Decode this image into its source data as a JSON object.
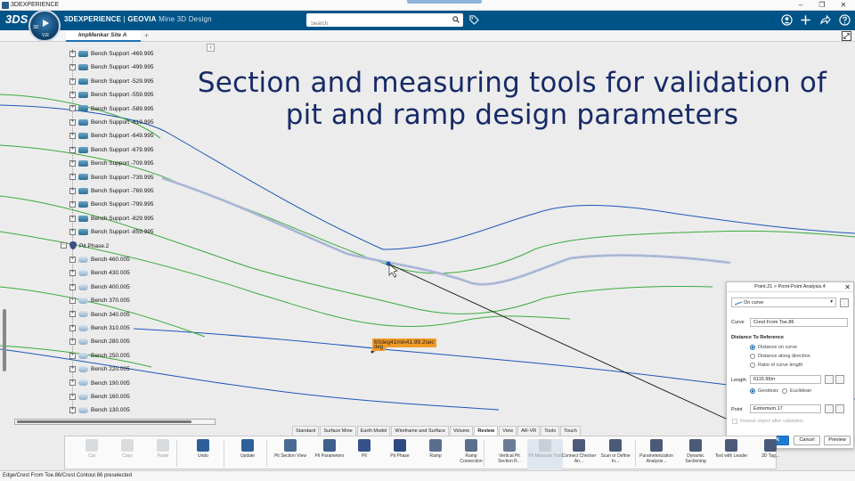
{
  "os_window": {
    "title": "3DEXPERIENCE",
    "min": "–",
    "max": "❐",
    "close": "✕"
  },
  "topbar": {
    "logo": "3DS",
    "compass": {
      "top": "3D",
      "bottom": "V,R"
    },
    "brand_bold": "3DEXPERIENCE",
    "brand_sep": " | ",
    "brand_geovia": "GEOVIA",
    "brand_app": " Mine 3D Design",
    "search_placeholder": "Search",
    "icons": [
      "tag-icon",
      "user-icon",
      "add-icon",
      "share-icon",
      "help-icon"
    ]
  },
  "tabs": {
    "active": "ImpMenkar Site A",
    "add": "+"
  },
  "tree": {
    "collapse": "‹",
    "items": [
      {
        "label": "Bench Support -469.995",
        "type": "support",
        "indent": 1
      },
      {
        "label": "Bench Support -499.995",
        "type": "support",
        "indent": 1
      },
      {
        "label": "Bench Support -529.995",
        "type": "support",
        "indent": 1
      },
      {
        "label": "Bench Support -559.995",
        "type": "support",
        "indent": 1
      },
      {
        "label": "Bench Support -589.995",
        "type": "support",
        "indent": 1
      },
      {
        "label": "Bench Support -619.995",
        "type": "support",
        "indent": 1
      },
      {
        "label": "Bench Support -649.995",
        "type": "support",
        "indent": 1
      },
      {
        "label": "Bench Support -679.995",
        "type": "support",
        "indent": 1
      },
      {
        "label": "Bench Support -709.995",
        "type": "support",
        "indent": 1
      },
      {
        "label": "Bench Support -739.995",
        "type": "support",
        "indent": 1
      },
      {
        "label": "Bench Support -769.995",
        "type": "support",
        "indent": 1
      },
      {
        "label": "Bench Support -799.995",
        "type": "support",
        "indent": 1
      },
      {
        "label": "Bench Support -829.995",
        "type": "support",
        "indent": 1
      },
      {
        "label": "Bench Support -859.995",
        "type": "support",
        "indent": 1
      },
      {
        "label": "Pit Phase.2",
        "type": "phase",
        "indent": 0
      },
      {
        "label": "Bench 460.005",
        "type": "bench",
        "indent": 1
      },
      {
        "label": "Bench 430.005",
        "type": "bench",
        "indent": 1
      },
      {
        "label": "Bench 400.005",
        "type": "bench",
        "indent": 1
      },
      {
        "label": "Bench 370.005",
        "type": "bench",
        "indent": 1
      },
      {
        "label": "Bench 340.005",
        "type": "bench",
        "indent": 1
      },
      {
        "label": "Bench 310.005",
        "type": "bench",
        "indent": 1
      },
      {
        "label": "Bench 280.005",
        "type": "bench",
        "indent": 1
      },
      {
        "label": "Bench 250.005",
        "type": "bench",
        "indent": 1
      },
      {
        "label": "Bench 220.005",
        "type": "bench",
        "indent": 1
      },
      {
        "label": "Bench 190.005",
        "type": "bench",
        "indent": 1
      },
      {
        "label": "Bench 160.005",
        "type": "bench",
        "indent": 1
      },
      {
        "label": "Bench 130.005",
        "type": "bench",
        "indent": 1
      }
    ]
  },
  "heading": {
    "line1": "Section and measuring  tools for validation of",
    "line2": "pit and ramp design parameters"
  },
  "viewport": {
    "angle_label": "60deg41min41.99.2sec",
    "angle_label_sub": "deg"
  },
  "dialog": {
    "title": "Point.21 > Point-Point Analysis.4",
    "close": "✕",
    "mode": "On curve",
    "curve_label": "Curve",
    "curve_value": "Crest From Toe.86",
    "section_title": "Distance To Reference",
    "options": [
      "Distance on curve",
      "Distance along direction",
      "Ratio of curve length"
    ],
    "selected_option": 0,
    "length_label": "Length",
    "length_value": "6115.99m",
    "geodesic": "Geodesic",
    "euclidean": "Euclidean",
    "point_label": "Point",
    "point_value": "Extremum.17",
    "repeat_label": "Repeat object after validation",
    "ok": "OK",
    "cancel": "Cancel",
    "preview": "Preview"
  },
  "command_tabs": [
    "Standard",
    "Surface Mine",
    "Earth Model",
    "Wireframe and Surface",
    "Volume",
    "Review",
    "View",
    "AR-VR",
    "Tools",
    "Touch"
  ],
  "active_tab": "Review",
  "toolbar": {
    "tools": [
      {
        "label": "Cut",
        "name": "cut-button",
        "icon": "scissors-icon",
        "disabled": true,
        "color": "#9aa3ad"
      },
      {
        "label": "Copy",
        "name": "copy-button",
        "icon": "copy-icon",
        "disabled": true,
        "color": "#9aa3ad"
      },
      {
        "label": "Paste",
        "name": "paste-button",
        "icon": "paste-icon",
        "disabled": true,
        "color": "#9aa3ad"
      },
      {
        "label": "Undo",
        "name": "undo-button",
        "icon": "undo-icon",
        "disabled": false,
        "color": "#2f5f9a"
      },
      {
        "label": "Update",
        "name": "update-button",
        "icon": "update-icon",
        "disabled": false,
        "color": "#2f5f9a"
      },
      {
        "label": "Pit Section View",
        "name": "pit-section-view-button",
        "icon": "section-view-icon",
        "disabled": false,
        "color": "#4a6b93"
      },
      {
        "label": "Pit Parameters",
        "name": "pit-parameters-button",
        "icon": "parameters-icon",
        "disabled": false,
        "color": "#3f5f8c"
      },
      {
        "label": "Pit",
        "name": "pit-button",
        "icon": "pit-icon",
        "disabled": false,
        "color": "#35508a"
      },
      {
        "label": "Pit Phase",
        "name": "pit-phase-button",
        "icon": "pit-phase-icon",
        "disabled": false,
        "color": "#2e4a80"
      },
      {
        "label": "Ramp",
        "name": "ramp-button",
        "icon": "ramp-icon",
        "disabled": false,
        "color": "#5a6f8e"
      },
      {
        "label": "Ramp Connection",
        "name": "ramp-connection-button",
        "icon": "ramp-connection-icon",
        "disabled": false,
        "color": "#5a6f8e"
      },
      {
        "label": "Vertical Pit Section R...",
        "name": "vertical-pit-section-button",
        "icon": "vertical-section-icon",
        "disabled": false,
        "color": "#6b7d96"
      },
      {
        "label": "Pit Measure Tool",
        "name": "pit-measure-tool-button",
        "icon": "measure-icon",
        "disabled": true,
        "color": "#9aa3ad"
      },
      {
        "label": "Connect Checker An...",
        "name": "connect-checker-button",
        "icon": "checker-icon",
        "disabled": false,
        "color": "#4a5a78"
      },
      {
        "label": "Scan or Define In...",
        "name": "scan-define-button",
        "icon": "scan-icon",
        "disabled": false,
        "color": "#4a5a78"
      },
      {
        "label": "Parameterization Analysis...",
        "name": "parameterization-analysis-button",
        "icon": "analysis-icon",
        "disabled": false,
        "color": "#4a5a78"
      },
      {
        "label": "Dynamic Sectioning",
        "name": "dynamic-sectioning-button",
        "icon": "sectioning-icon",
        "disabled": false,
        "color": "#4a5a78"
      },
      {
        "label": "Text with Leader",
        "name": "text-with-leader-button",
        "icon": "text-leader-icon",
        "disabled": false,
        "color": "#4a5a78"
      },
      {
        "label": "3D Tag...",
        "name": "3d-tag-button",
        "icon": "tag3d-icon",
        "disabled": false,
        "color": "#4a5a78"
      }
    ]
  },
  "status": "Edge/Crest From Toe.86/Crest Contour.86 preselected",
  "colors": {
    "topbar": "#005386",
    "heading": "#172a67",
    "contour_blue": "#1c55b8",
    "contour_green": "#3caa3c",
    "label_orange": "#f29b24"
  }
}
